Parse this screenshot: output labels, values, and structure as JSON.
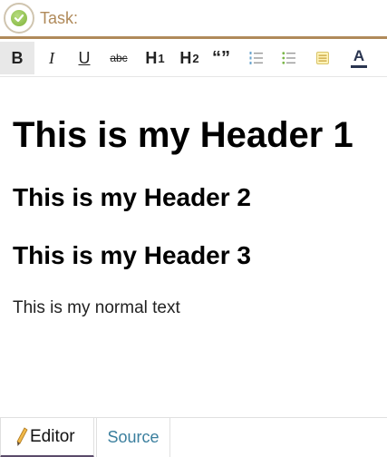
{
  "task": {
    "label": "Task:",
    "icon": "check-circle-icon",
    "accent_color": "#b08a5a"
  },
  "toolbar": {
    "bold": "B",
    "italic": "I",
    "underline": "U",
    "strikethrough": "abc",
    "h1": "H",
    "h1_sub": "1",
    "h2": "H",
    "h2_sub": "2",
    "quote": "“”",
    "ordered_list_icon": "ordered-list-icon",
    "bullet_list_icon": "bullet-list-icon",
    "highlight_icon": "highlight-icon",
    "font_color_label": "A"
  },
  "editor": {
    "header1": "This is my Header 1",
    "header2": "This is my Header 2",
    "header3": "This is my Header 3",
    "normal_text": "This is my normal text"
  },
  "tabs": [
    {
      "label": "Editor",
      "icon": "pencil-icon",
      "active": true
    },
    {
      "label": "Source",
      "active": false
    }
  ],
  "colors": {
    "source_tab": "#3b7f9e",
    "active_tab_indicator": "#5a4a6a"
  }
}
